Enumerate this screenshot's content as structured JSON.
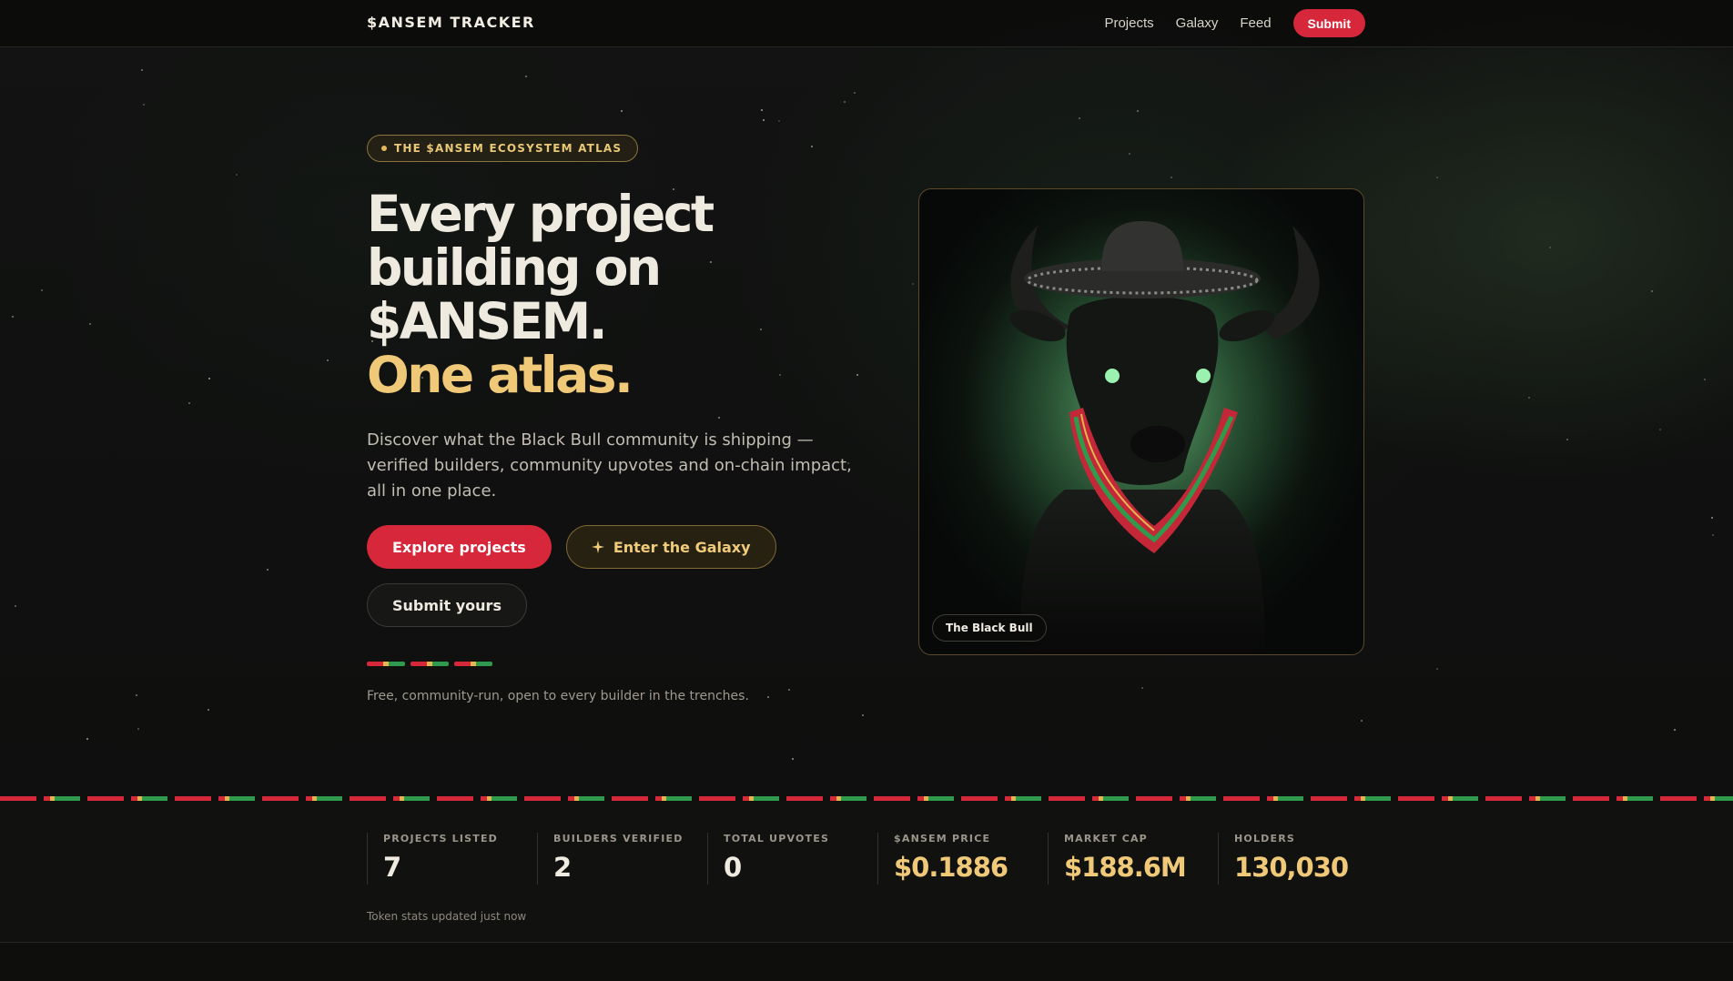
{
  "nav": {
    "brand": "$ANSEM TRACKER",
    "links": [
      "Projects",
      "Galaxy",
      "Feed"
    ],
    "submit_label": "Submit"
  },
  "hero": {
    "eyebrow": "THE $ANSEM ECOSYSTEM ATLAS",
    "headline_lines": [
      "Every project",
      "building on",
      "$ANSEM."
    ],
    "headline_accent": "One atlas.",
    "lede": "Discover what the Black Bull community is shipping — verified builders, community upvotes and on-chain impact, all in one place.",
    "cta_primary": "Explore projects",
    "cta_secondary": "Enter the Galaxy",
    "cta_secondary_icon": "sparkle-icon",
    "cta_tertiary": "Submit yours",
    "fine_print": "Free, community-run, open to every builder in the trenches."
  },
  "card": {
    "caption": "The Black Bull",
    "image": "black-bull-sombrero-image"
  },
  "stats": [
    {
      "label": "PROJECTS LISTED",
      "value": "7",
      "accent": false
    },
    {
      "label": "BUILDERS VERIFIED",
      "value": "2",
      "accent": false
    },
    {
      "label": "TOTAL UPVOTES",
      "value": "0",
      "accent": false
    },
    {
      "label": "$ANSEM PRICE",
      "value": "$0.1886",
      "accent": true
    },
    {
      "label": "MARKET CAP",
      "value": "$188.6M",
      "accent": true
    },
    {
      "label": "HOLDERS",
      "value": "130,030",
      "accent": true
    }
  ],
  "stats_note": "Token stats updated just now",
  "colors": {
    "accent_red": "#d6283a",
    "accent_gold": "#efc878",
    "accent_green": "#2f9a4b",
    "background": "#0f0f0e"
  }
}
